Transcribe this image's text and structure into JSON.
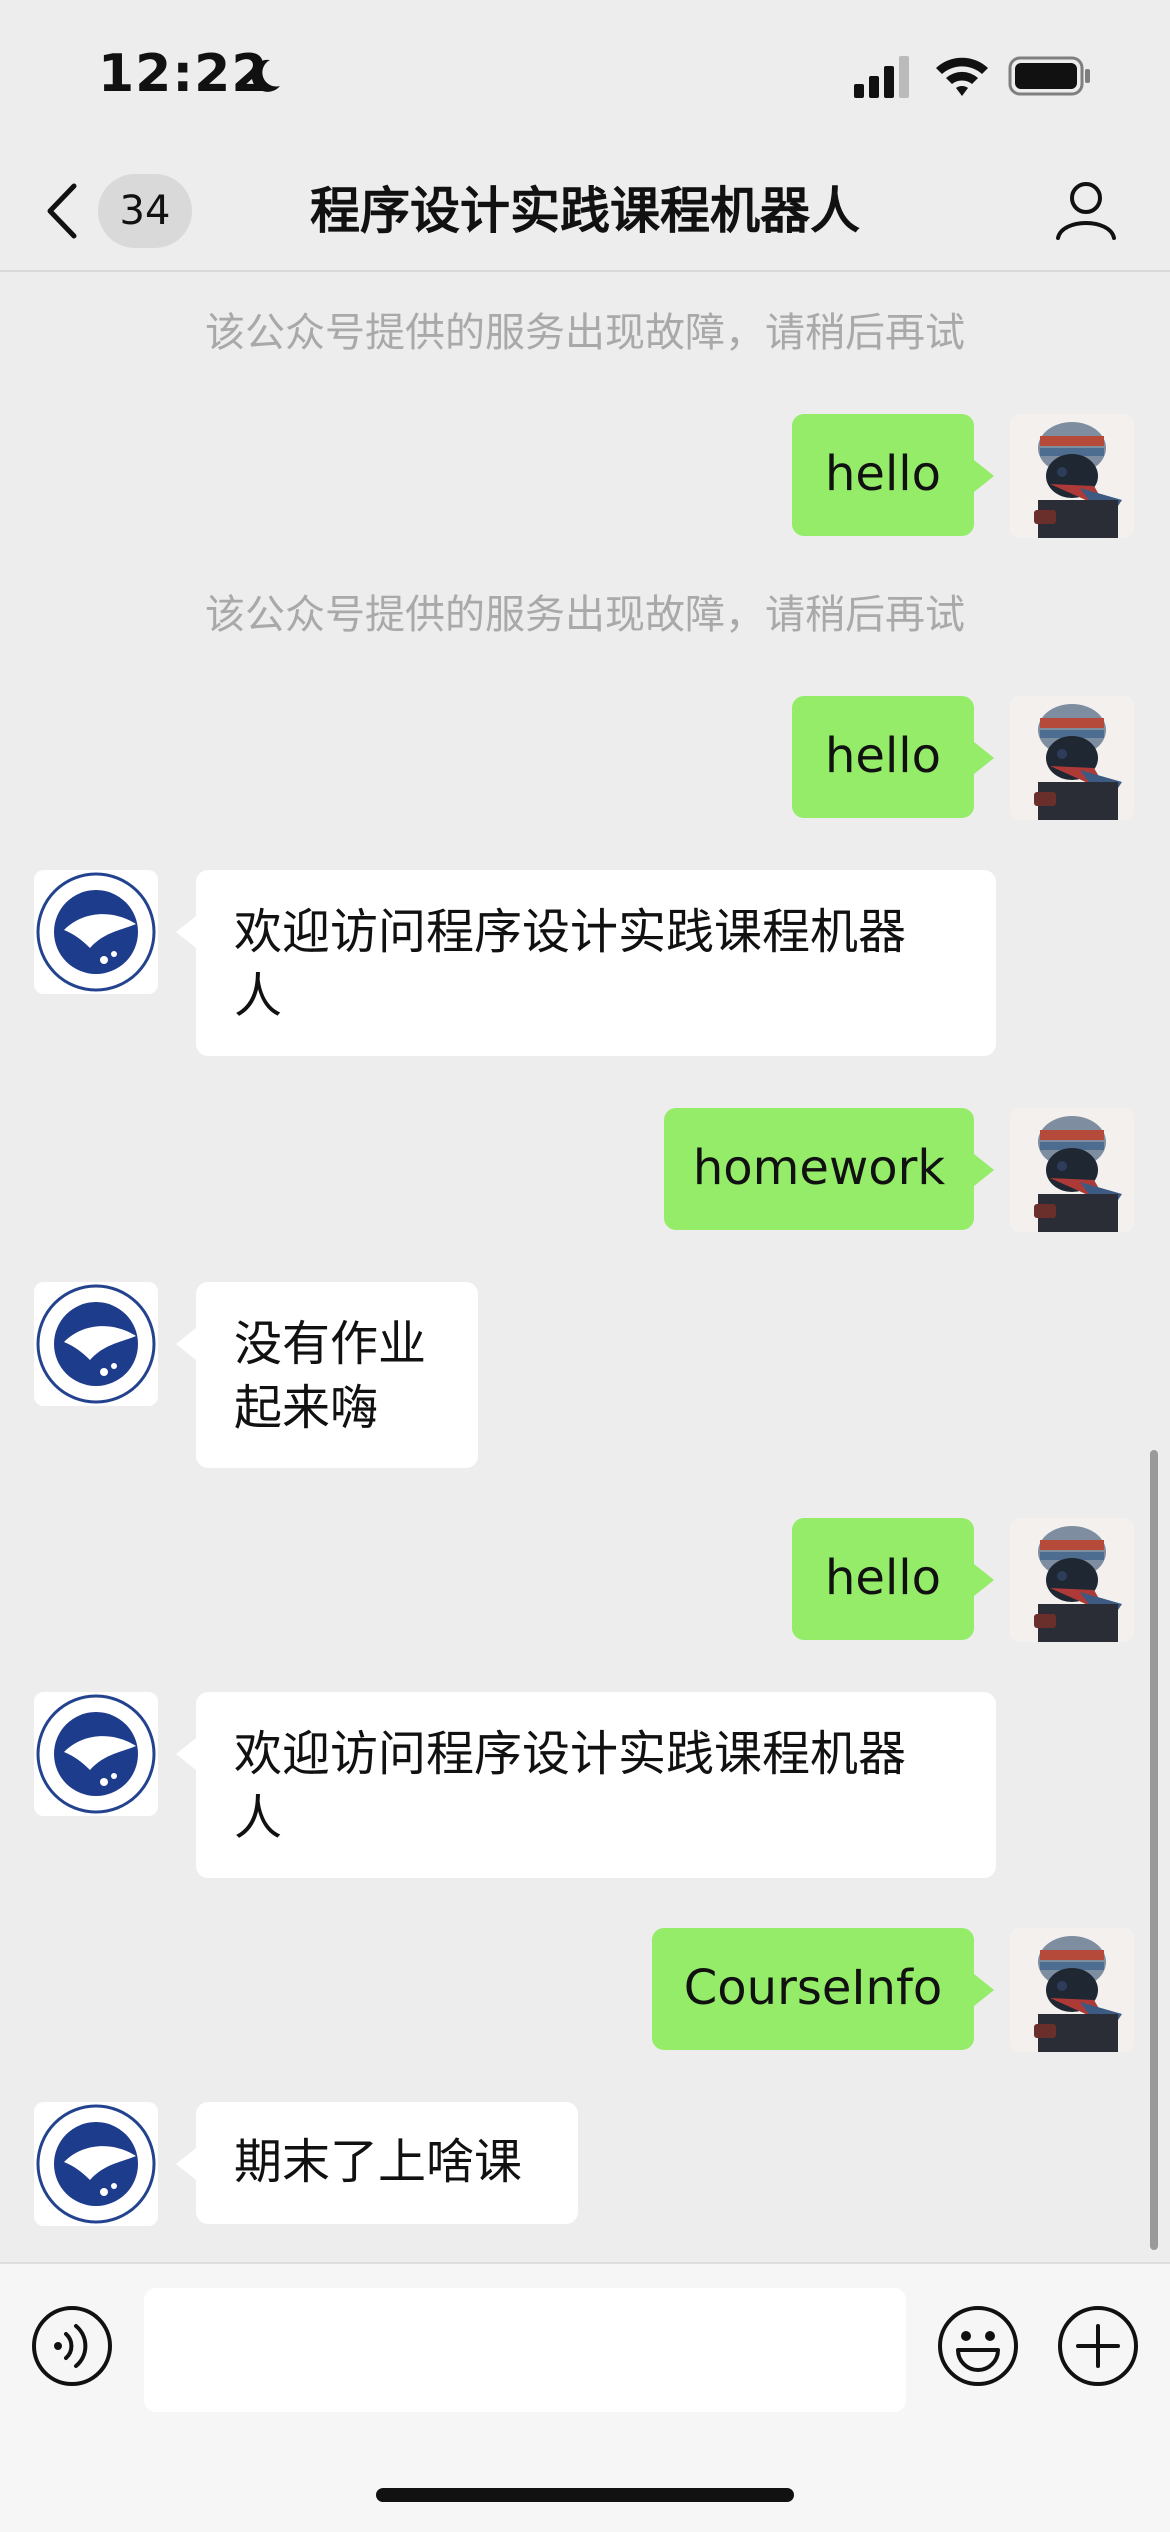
{
  "status_bar": {
    "time": "12:22"
  },
  "nav": {
    "unread_count": "34",
    "title": "程序设计实践课程机器人"
  },
  "chat": {
    "system_notice_1": "该公众号提供的服务出现故障，请稍后再试",
    "msg_1": "hello",
    "system_notice_2": "该公众号提供的服务出现故障，请稍后再试",
    "msg_2": "hello",
    "msg_3_line1": "欢迎访问程序设计实践课程机器",
    "msg_3_line2": "人",
    "msg_4": "homework",
    "msg_5_line1": "没有作业",
    "msg_5_line2": "起来嗨",
    "msg_6": "hello",
    "msg_7_line1": "欢迎访问程序设计实践课程机器",
    "msg_7_line2": "人",
    "msg_8": "CourseInfo",
    "msg_9": "期末了上啥课"
  },
  "input": {
    "value": "",
    "placeholder": ""
  },
  "colors": {
    "background": "#ededed",
    "outgoing_bubble": "#95ec69",
    "incoming_bubble": "#ffffff",
    "notice_text": "#a9a9a9"
  },
  "icons": [
    "moon-icon",
    "signal-icon",
    "wifi-icon",
    "battery-icon",
    "back-icon",
    "profile-icon",
    "user-avatar",
    "bot-avatar-logo",
    "voice-icon",
    "emoji-icon",
    "plus-icon"
  ]
}
